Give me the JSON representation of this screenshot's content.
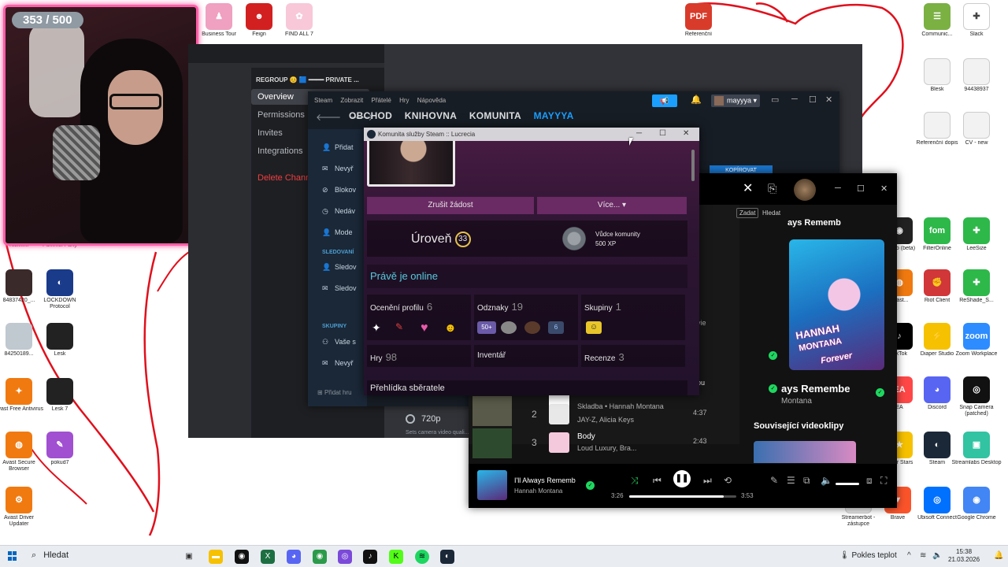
{
  "webcam": {
    "counter": "353 / 500"
  },
  "desktop_icons": [
    {
      "id": "d1",
      "label": "Business Tour",
      "color": "#f0a0c0",
      "glyph": "♟"
    },
    {
      "id": "d2",
      "label": "Feign",
      "color": "#d22020",
      "glyph": "☻"
    },
    {
      "id": "d3",
      "label": "FIND ALL 7",
      "color": "#f8c8d8",
      "glyph": "✿"
    },
    {
      "id": "d4",
      "label": "Referenční",
      "color": "#d83b2a",
      "glyph": "PDF"
    },
    {
      "id": "d5",
      "label": "Communic...",
      "color": "#7bb043",
      "glyph": "☰"
    },
    {
      "id": "d6",
      "label": "Slack",
      "color": "#ffffff",
      "glyph": "✚"
    },
    {
      "id": "d7",
      "label": "Blesk",
      "color": "#f2f2f2",
      "glyph": ""
    },
    {
      "id": "d8",
      "label": "94438937",
      "color": "#f2f2f2",
      "glyph": ""
    },
    {
      "id": "d9",
      "label": "Referenční dopis",
      "color": "#f2f2f2",
      "glyph": ""
    },
    {
      "id": "d10",
      "label": "CV - new",
      "color": "#f2f2f2",
      "glyph": ""
    },
    {
      "id": "d11",
      "label": "Kick.lnk",
      "color": "#e0e0e0",
      "glyph": ""
    },
    {
      "id": "d12",
      "label": "Pummel Party",
      "color": "#e0e0e0",
      "glyph": ""
    },
    {
      "id": "d13",
      "label": "84837420_...",
      "color": "#3a2a2a",
      "glyph": ""
    },
    {
      "id": "d14",
      "label": "LOCKDOWN Protocol",
      "color": "#1a3a8a",
      "glyph": "◐"
    },
    {
      "id": "d15",
      "label": "84250189...",
      "color": "#c0c8d0",
      "glyph": ""
    },
    {
      "id": "d16",
      "label": "Lesk",
      "color": "#222222",
      "glyph": ""
    },
    {
      "id": "d17",
      "label": "Avast Free Antivirus",
      "color": "#f07a10",
      "glyph": "✦"
    },
    {
      "id": "d18",
      "label": "Lesk 7",
      "color": "#222222",
      "glyph": ""
    },
    {
      "id": "d19",
      "label": "Avast Secure Browser",
      "color": "#f07a10",
      "glyph": "◍"
    },
    {
      "id": "d20",
      "label": "pokud7",
      "color": "#a050d0",
      "glyph": "✎"
    },
    {
      "id": "d21",
      "label": "Avast Driver Updater",
      "color": "#f07a10",
      "glyph": "⚙"
    },
    {
      "id": "d22",
      "label": "Studio (beta)",
      "color": "#222222",
      "glyph": "◉"
    },
    {
      "id": "d23",
      "label": "FilterOnline",
      "color": "#2eb84a",
      "glyph": "fom"
    },
    {
      "id": "d24",
      "label": "LeeSize",
      "color": "#2eb84a",
      "glyph": "✚"
    },
    {
      "id": "d25",
      "label": "Avast...",
      "color": "#f07a10",
      "glyph": "◍"
    },
    {
      "id": "d26",
      "label": "Riot Client",
      "color": "#d13639",
      "glyph": "✊"
    },
    {
      "id": "d27",
      "label": "ReShade_S...",
      "color": "#2eb84a",
      "glyph": "✚"
    },
    {
      "id": "d28",
      "label": "TikTok",
      "color": "#000000",
      "glyph": "♪"
    },
    {
      "id": "d29",
      "label": "Diaper Studio",
      "color": "#f6c100",
      "glyph": "⚡"
    },
    {
      "id": "d30",
      "label": "Zoom Workplace",
      "color": "#2d8cff",
      "glyph": "zoom"
    },
    {
      "id": "d31",
      "label": "EA",
      "color": "#ff4747",
      "glyph": "EA"
    },
    {
      "id": "d32",
      "label": "Discord",
      "color": "#5865f2",
      "glyph": "◕"
    },
    {
      "id": "d33",
      "label": "Snap Camera (patched)",
      "color": "#111111",
      "glyph": "◎"
    },
    {
      "id": "d34",
      "label": "Polar Stars",
      "color": "#f6c100",
      "glyph": "★"
    },
    {
      "id": "d35",
      "label": "Steam",
      "color": "#1b2838",
      "glyph": "◐"
    },
    {
      "id": "d36",
      "label": "Streamlabs Desktop",
      "color": "#31c3a2",
      "glyph": "▣"
    },
    {
      "id": "d37",
      "label": "Streamerbot - zástupce",
      "color": "#e6e6e6",
      "glyph": ""
    },
    {
      "id": "d38",
      "label": "Brave",
      "color": "#fb542b",
      "glyph": "▼"
    },
    {
      "id": "d39",
      "label": "Ubisoft Connect",
      "color": "#0070ff",
      "glyph": "◎"
    },
    {
      "id": "d40",
      "label": "Google Chrome",
      "color": "#4285f4",
      "glyph": "◉"
    }
  ],
  "discord": {
    "server_title": "REGROUP 😊 🟦 ━━━━ PRIVATE ...",
    "nav": [
      "Overview",
      "Permissions",
      "Invites",
      "Integrations",
      "Delete Channel"
    ],
    "camera_option": "720p",
    "camera_help": "Sets camera video quali..."
  },
  "steam": {
    "menu": [
      "Steam",
      "Zobrazit",
      "Přátelé",
      "Hry",
      "Nápověda"
    ],
    "nav": [
      "OBCHOD",
      "KNIHOVNA",
      "KOMUNITA",
      "MAYYYA"
    ],
    "username": "mayyya",
    "copy_button": "KOPÍROVAT",
    "sidebar_items": [
      "Přidat",
      "Nevyř",
      "Blokov",
      "Nedáv",
      "Mode"
    ],
    "sidebar_head_1": "SLEDOVANÍ",
    "sidebar_items_2": [
      "Sledov",
      "Sledov"
    ],
    "sidebar_head_2": "SKUPINY",
    "sidebar_items_3": [
      "Vaše s",
      "Nevyř"
    ],
    "add_game": "Přidat hru"
  },
  "profile": {
    "window_title": "Komunita služby Steam :: Lucrecia",
    "btn_cancel": "Zrušit žádost",
    "btn_more": "Více...",
    "level_label": "Úroveň",
    "level": "33",
    "medal_name": "Vůdce komunity",
    "medal_xp": "500 XP",
    "online": "Právě je online",
    "cells": {
      "awards_label": "Ocenění profilu",
      "awards_count": "6",
      "badges_label": "Odznaky",
      "badges_count": "19",
      "groups_label": "Skupiny",
      "groups_count": "1",
      "games_label": "Hry",
      "games_count": "98",
      "inventory_label": "Inventář",
      "reviews_label": "Recenze",
      "reviews_count": "3"
    },
    "badge_50": "50+",
    "badge_6": "6",
    "collector": "Přehlídka sběratele"
  },
  "spotify": {
    "tag_enter": "Zadat",
    "tag_search": "Hledat",
    "cover_line1": "HANNAH",
    "cover_line2": "MONTANA",
    "cover_line3": "Forever",
    "heading_partial": "ays Remembe",
    "heading_partial_top": "ays Rememb",
    "now_title": "ays Remembe",
    "now_artist": "Montana",
    "related_videos": "Související videoklipy",
    "partial_vie": "vie",
    "partial_ou": "ou",
    "tracks": [
      {
        "num": "",
        "title": "",
        "artist": "Skladba • Hannah Montana",
        "duration": ""
      },
      {
        "num": "2",
        "title": "",
        "artist": "JAY-Z, Alicia Keys",
        "duration": "4:37"
      },
      {
        "num": "3",
        "title": "Body",
        "artist": "Loud Luxury, Bra...",
        "duration": "2:43"
      }
    ],
    "player": {
      "title": "I'll Always Rememb",
      "artist": "Hannah Montana",
      "elapsed": "3:26",
      "total": "3:53",
      "progress": 0.88
    }
  },
  "taskbar": {
    "search": "Hledat",
    "weather": "Pokles teplot",
    "time": "15:38",
    "date": "21.03.2026"
  }
}
